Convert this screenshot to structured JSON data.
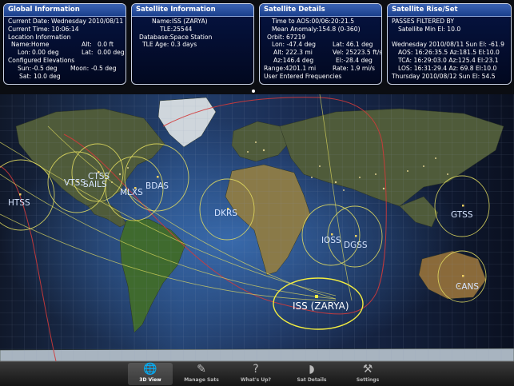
{
  "panels": {
    "global": {
      "title": "Global Information",
      "date": "Current Date: Wednesday 2010/08/11",
      "time": "Current Time: 10:06:14",
      "loc_header": "Location Information",
      "name": "Name:Home",
      "alt_label": "Alt:",
      "alt_value": "0.0 ft",
      "lon_label": "Lon:",
      "lon_value": "0.00 deg",
      "lat_label": "Lat:",
      "lat_value": "0.00 deg",
      "elev_header": "Configured Elevations",
      "sun_label": "Sun:",
      "sun_value": "-0.5 deg",
      "moon_label": "Moon:",
      "moon_value": "-0.5 deg",
      "sat_label": "Sat:",
      "sat_value": "10.0 deg"
    },
    "satinfo": {
      "title": "Satellite Information",
      "name": "Name:ISS (ZARYA)",
      "tle": "TLE:25544",
      "database": "Database:Space Station",
      "tle_age": "TLE Age: 0.3 days"
    },
    "details": {
      "title": "Satellite Details",
      "time_aos": "Time to AOS:00/06:20:21.5",
      "anomaly": "Mean Anomaly:154.8 (0-360)",
      "orbit": "Orbit: 67219",
      "lon": "Lon: -47.4 deg",
      "lat": "Lat: 46.1 deg",
      "alt": "Alt: 222.3 mi",
      "vel": "Vel: 25223.5 ft/s",
      "az": "Az:146.4 deg",
      "el": "El:-28.4 deg",
      "range": "Range:4201.1 mi",
      "rate": "Rate: 1.9 mi/s",
      "user_freq": "User Entered Frequencies"
    },
    "riseset": {
      "title": "Satellite Rise/Set",
      "filter": "PASSES FILTERED BY",
      "min_el": "Satellite Min El: 10.0",
      "day1": "Wednesday 2010/08/11 Sun El: -61.9",
      "aos": "AOS: 16:26:35.5 Az:181.5 El:10.0",
      "tca": "TCA: 16:29:03.0 Az:125.4 El:23.1",
      "los": "LOS: 16:31:29.4 Az: 69.8 El:10.0",
      "day2": "Thursday 2010/08/12 Sun El: 54.5"
    }
  },
  "stations": [
    "HTSS",
    "VTSS",
    "CTSS",
    "SAILS",
    "MLXS",
    "BDAS",
    "DKRS",
    "IOSS",
    "DGSS",
    "GTSS",
    "CANS"
  ],
  "satellite_label": "ISS (ZARYA)",
  "tabs": [
    "3D View",
    "Manage Sats",
    "What's Up?",
    "Sat Details",
    "Settings"
  ],
  "colors": {
    "panel_title": "#2a55a8",
    "ground_track": "#d23a3a",
    "footprint": "#e6e060"
  }
}
